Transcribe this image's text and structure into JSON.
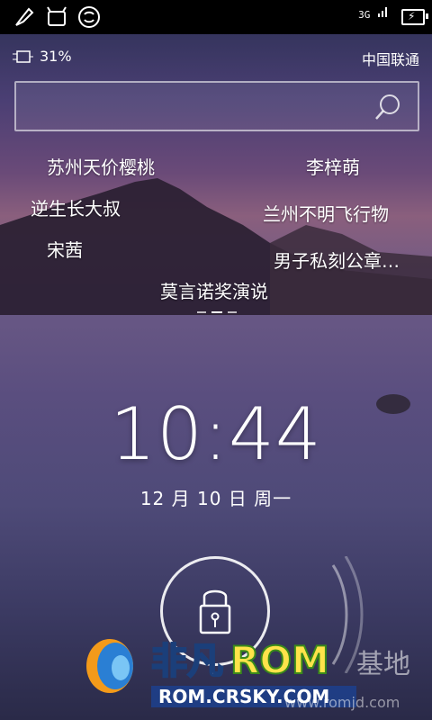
{
  "status_icons": [
    "brush-icon",
    "bot-icon",
    "s-icon"
  ],
  "network": {
    "label": "3G"
  },
  "info": {
    "battery_percent": "31%",
    "carrier": "中国联通"
  },
  "search": {
    "value": "",
    "placeholder": ""
  },
  "keywords": [
    "苏州天价樱桃",
    "李梓萌",
    "逆生长大叔",
    "兰州不明飞行物",
    "宋茜",
    "男子私刻公章…",
    "莫言诺奖演说"
  ],
  "pager": {
    "current": 2,
    "total": 3
  },
  "clock": {
    "time": "10:44",
    "date": "12 月 10 日 周一"
  },
  "watermark": {
    "brand_a": "非凡",
    "brand_b": "ROM",
    "brand_c": "基地",
    "url": "ROM.CRSKY.COM",
    "url2": "www.romjd.com"
  }
}
